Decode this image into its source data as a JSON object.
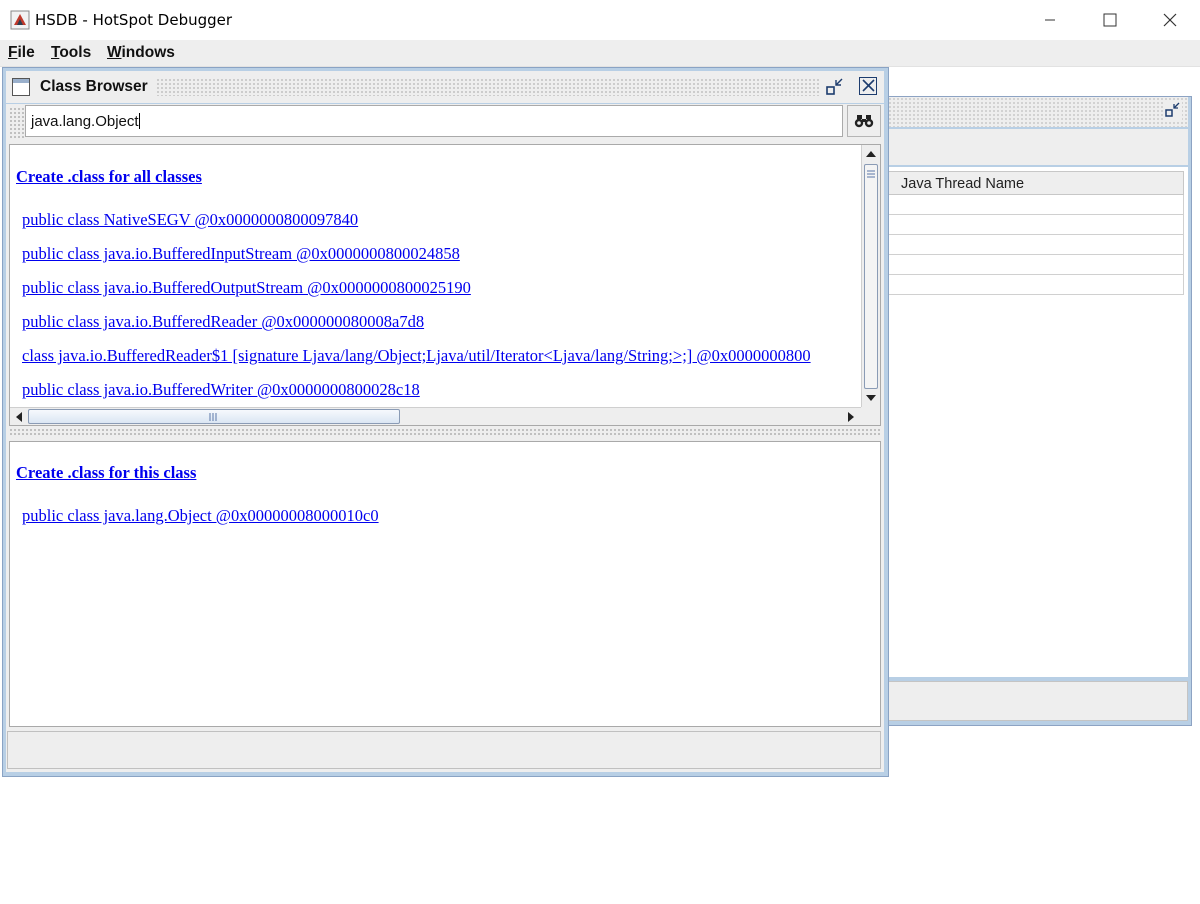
{
  "window": {
    "title": "HSDB - HotSpot Debugger",
    "minimize_glyph": "—",
    "maximize_glyph": "☐",
    "close_glyph": "✕"
  },
  "menubar": {
    "items": [
      {
        "mnemonic": "F",
        "rest": "ile"
      },
      {
        "mnemonic": "T",
        "rest": "ools"
      },
      {
        "mnemonic": "W",
        "rest": "indows"
      }
    ]
  },
  "background_frame": {
    "table_header": "Java Thread Name"
  },
  "class_browser": {
    "title": "Class Browser",
    "search": {
      "value": "java.lang.Object",
      "button_icon": "binoculars-icon"
    },
    "class_list": {
      "create_all_link": "Create .class for all classes",
      "classes": [
        "public class NativeSEGV @0x0000000800097840",
        "public class java.io.BufferedInputStream @0x0000000800024858",
        "public class java.io.BufferedOutputStream @0x0000000800025190",
        "public class java.io.BufferedReader @0x000000080008a7d8",
        "class java.io.BufferedReader$1 [signature Ljava/lang/Object;Ljava/util/Iterator<Ljava/lang/String;>;] @0x0000000800",
        "public class java.io.BufferedWriter @0x0000000800028c18"
      ]
    },
    "detail": {
      "create_this_link": "Create .class for this class",
      "selected_class": "public class java.lang.Object @0x00000008000010c0"
    }
  },
  "colors": {
    "link": "#0000ee",
    "frame_border": "#b8cfe5",
    "panel_bg": "#eeeeee"
  }
}
